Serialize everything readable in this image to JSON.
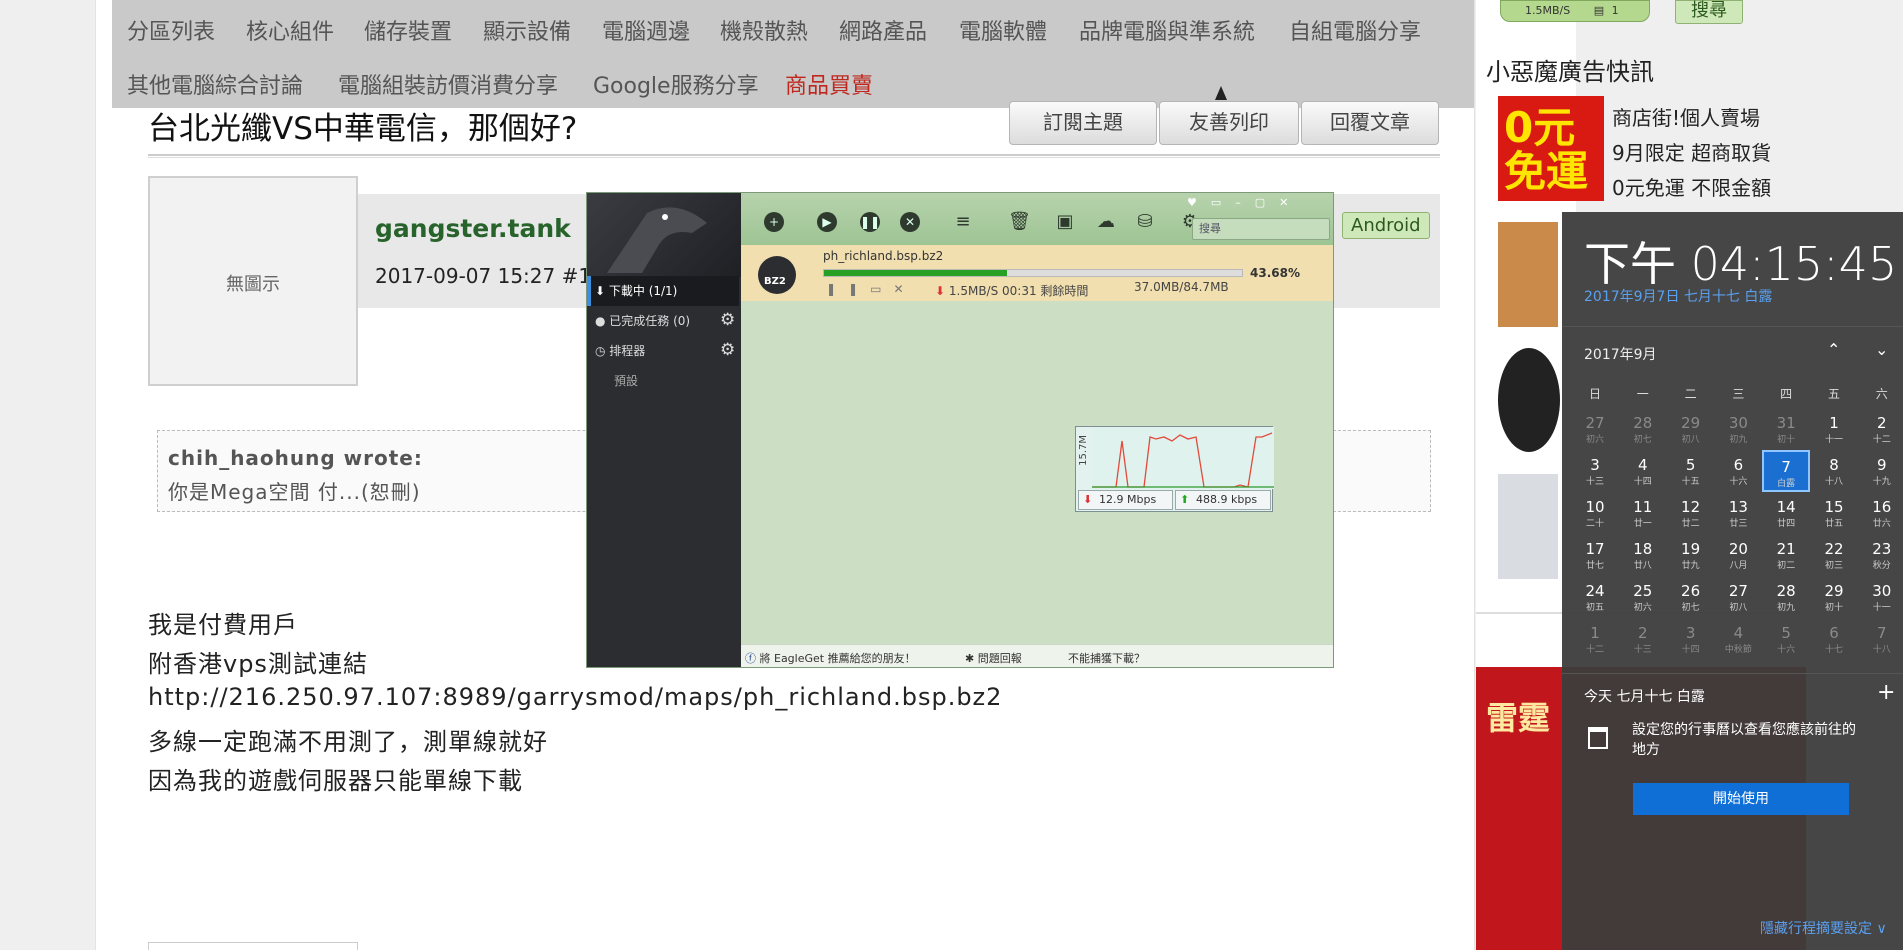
{
  "nav": {
    "items": [
      "分區列表",
      "核心組件",
      "儲存裝置",
      "顯示設備",
      "電腦週邊",
      "機殼散熱",
      "網路產品",
      "電腦軟體",
      "品牌電腦與準系統",
      "自組電腦分享"
    ],
    "items2": [
      "其他電腦綜合討論",
      "電腦組裝訪價消費分享",
      "Google服務分享",
      "商品買賣"
    ]
  },
  "topic": {
    "title": "台北光纖VS中華電信，那個好?",
    "subscribe": "訂閱主題",
    "print": "友善列印",
    "reply": "回覆文章"
  },
  "post": {
    "avatar_text": "無圖示",
    "username": "gangster.tank",
    "date": "2017-09-07 15:27  #11",
    "device_badge": "Android",
    "quote_author": "chih_haohung wrote:",
    "quote_text": "你是Mega空間 付...(恕刪)",
    "lines": [
      "我是付費用戶",
      "附香港vps測試連結",
      "http://216.250.97.107:8989/garrysmod/maps/ph_richland.bsp.bz2",
      "多線一定跑滿不用測了，測單線就好",
      "因為我的遊戲伺服器只能單線下載"
    ]
  },
  "sidebar": {
    "widget_speed": "1.5MB/S",
    "widget_count": "1",
    "search_button": "搜尋",
    "ad_title": "小惡魔廣告快訊",
    "ad_img_text": "0元\n免運",
    "ad_lines": [
      "商店街!個人賣場",
      "9月限定 超商取貨",
      "0元免運 不限金額"
    ],
    "ad_banner": "雷霆"
  },
  "eagleget": {
    "search_placeholder": "搜尋",
    "file_name": "ph_richland.bsp.bz2",
    "file_ext": "BZ2",
    "progress_percent": 43.68,
    "progress_label": "43.68%",
    "speed_line": "1.5MB/S 00:31 剩餘時間",
    "size_line": "37.0MB/84.7MB",
    "side": {
      "downloading": "下載中 (1/1)",
      "completed": "已完成任務 (0)",
      "scheduler": "排程器",
      "default": "預設"
    },
    "graph": {
      "y_label": "15.7M",
      "down": "12.9 Mbps",
      "up": "488.9 kbps"
    },
    "footer": {
      "recommend": "將 EagleGet 推薦給您的朋友！",
      "feedback": "問題回報",
      "cannot_capture": "不能捕獲下載？"
    }
  },
  "calendar": {
    "time": "下午 04:15:45",
    "date_line": "2017年9月7日 七月十七 白露",
    "month": "2017年9月",
    "weekdays": [
      "日",
      "一",
      "二",
      "三",
      "四",
      "五",
      "六"
    ],
    "days": [
      {
        "n": "27",
        "l": "初六",
        "dim": true
      },
      {
        "n": "28",
        "l": "初七",
        "dim": true
      },
      {
        "n": "29",
        "l": "初八",
        "dim": true
      },
      {
        "n": "30",
        "l": "初九",
        "dim": true
      },
      {
        "n": "31",
        "l": "初十",
        "dim": true
      },
      {
        "n": "1",
        "l": "十一"
      },
      {
        "n": "2",
        "l": "十二"
      },
      {
        "n": "3",
        "l": "十三"
      },
      {
        "n": "4",
        "l": "十四"
      },
      {
        "n": "5",
        "l": "十五"
      },
      {
        "n": "6",
        "l": "十六"
      },
      {
        "n": "7",
        "l": "白露",
        "today": true
      },
      {
        "n": "8",
        "l": "十八"
      },
      {
        "n": "9",
        "l": "十九"
      },
      {
        "n": "10",
        "l": "二十"
      },
      {
        "n": "11",
        "l": "廿一"
      },
      {
        "n": "12",
        "l": "廿二"
      },
      {
        "n": "13",
        "l": "廿三"
      },
      {
        "n": "14",
        "l": "廿四"
      },
      {
        "n": "15",
        "l": "廿五"
      },
      {
        "n": "16",
        "l": "廿六"
      },
      {
        "n": "17",
        "l": "廿七"
      },
      {
        "n": "18",
        "l": "廿八"
      },
      {
        "n": "19",
        "l": "廿九"
      },
      {
        "n": "20",
        "l": "八月"
      },
      {
        "n": "21",
        "l": "初二"
      },
      {
        "n": "22",
        "l": "初三"
      },
      {
        "n": "23",
        "l": "秋分"
      },
      {
        "n": "24",
        "l": "初五"
      },
      {
        "n": "25",
        "l": "初六"
      },
      {
        "n": "26",
        "l": "初七"
      },
      {
        "n": "27",
        "l": "初八"
      },
      {
        "n": "28",
        "l": "初九"
      },
      {
        "n": "29",
        "l": "初十"
      },
      {
        "n": "30",
        "l": "十一"
      },
      {
        "n": "1",
        "l": "十二",
        "dim": true
      },
      {
        "n": "2",
        "l": "十三",
        "dim": true
      },
      {
        "n": "3",
        "l": "十四",
        "dim": true
      },
      {
        "n": "4",
        "l": "中秋節",
        "dim": true
      },
      {
        "n": "5",
        "l": "十六",
        "dim": true
      },
      {
        "n": "6",
        "l": "十七",
        "dim": true
      },
      {
        "n": "7",
        "l": "十八",
        "dim": true
      }
    ],
    "today_label": "今天 七月十七 白露",
    "hint": "設定您的行事曆以查看您應該前往的地方",
    "start_button": "開始使用",
    "hide_agenda": "隱藏行程摘要設定 ∨"
  }
}
